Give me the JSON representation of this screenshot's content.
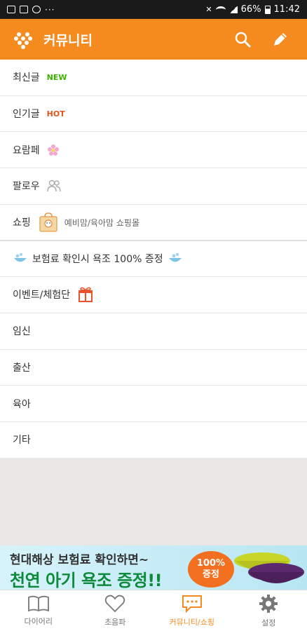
{
  "status_bar": {
    "battery": "66%",
    "time": "11:42",
    "more": "···"
  },
  "header": {
    "title": "커뮤니티",
    "search_icon": "search-icon",
    "write_icon": "pencil-icon"
  },
  "menu": [
    {
      "label": "최신글",
      "badge": "NEW"
    },
    {
      "label": "인기글",
      "badge": "HOT"
    },
    {
      "label": "요람페",
      "icon": "flower-icon"
    },
    {
      "label": "팔로우",
      "icon": "people-icon"
    },
    {
      "label": "쇼핑",
      "icon": "shopping-bag-icon",
      "sub": "예비맘/육아맘 쇼핑몰"
    },
    {
      "label": "보험료 확인시 욕조 100% 증정",
      "icon": "bathtub-icon"
    },
    {
      "label": "이벤트/체험단",
      "icon": "gift-icon"
    },
    {
      "label": "임신"
    },
    {
      "label": "출산"
    },
    {
      "label": "육아"
    },
    {
      "label": "기타"
    }
  ],
  "ad": {
    "line1": "현대해상 보험료 확인하면~",
    "line2": "천연 아기 욕조 증정!!",
    "badge_top": "100%",
    "badge_bottom": "증정"
  },
  "tabs": [
    {
      "label": "다이어리",
      "icon": "book-icon"
    },
    {
      "label": "초음파",
      "icon": "heart-icon"
    },
    {
      "label": "커뮤니티/쇼핑",
      "icon": "chat-icon",
      "active": true
    },
    {
      "label": "설정",
      "icon": "gear-icon"
    }
  ],
  "colors": {
    "accent": "#f58a1f",
    "new": "#3cb300",
    "hot": "#e2541a",
    "ad_green": "#0d8a3a"
  }
}
